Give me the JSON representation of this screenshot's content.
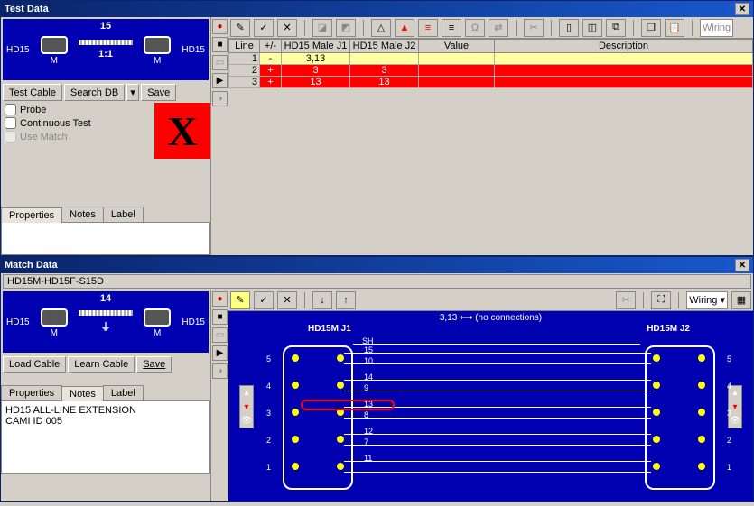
{
  "top_window": {
    "title": "Test Data",
    "connector": {
      "count": "15",
      "left": "HD15",
      "right": "HD15",
      "leftgender": "M",
      "rightgender": "M",
      "ratio": "1:1"
    },
    "buttons": {
      "test_cable": "Test Cable",
      "search_db": "Search DB",
      "save": "Save"
    },
    "checks": {
      "probe": "Probe",
      "continuous": "Continuous Test",
      "use_match": "Use Match"
    },
    "big_x": "X",
    "tabs": {
      "properties": "Properties",
      "notes": "Notes",
      "label": "Label"
    },
    "drop_wiring": "Wiring",
    "table": {
      "headers": {
        "line": "Line",
        "pm": "+/-",
        "j1": "HD15 Male J1",
        "j2": "HD15 Male J2",
        "value": "Value",
        "desc": "Description"
      },
      "rows": [
        {
          "line": "1",
          "pm": "-",
          "j1": "3,13",
          "j2": "",
          "cls": "yellow"
        },
        {
          "line": "2",
          "pm": "+",
          "j1": "3",
          "j2": "3",
          "cls": "red"
        },
        {
          "line": "3",
          "pm": "+",
          "j1": "13",
          "j2": "13",
          "cls": "red"
        }
      ]
    }
  },
  "bottom_window": {
    "title": "Match Data",
    "subtitle": "HD15M-HD15F-S15D",
    "connector": {
      "count": "14",
      "left": "HD15",
      "right": "HD15",
      "leftgender": "M",
      "rightgender": "M"
    },
    "buttons": {
      "load_cable": "Load Cable",
      "learn_cable": "Learn Cable",
      "save": "Save"
    },
    "tabs": {
      "properties": "Properties",
      "notes": "Notes",
      "label": "Label"
    },
    "notes_text1": "HD15 ALL-LINE EXTENSION",
    "notes_text2": "CAMI ID 005",
    "drop_wiring": "Wiring",
    "schematic": {
      "msg": "3,13 ⟷ (no connections)",
      "left_label": "HD15M J1",
      "right_label": "HD15M J2",
      "sh": "SH",
      "rows": [
        "5",
        "4",
        "3",
        "2",
        "1"
      ],
      "top_labels": [
        "15",
        "10",
        "14",
        "9",
        "13",
        "8",
        "12",
        "7",
        "11"
      ]
    }
  }
}
